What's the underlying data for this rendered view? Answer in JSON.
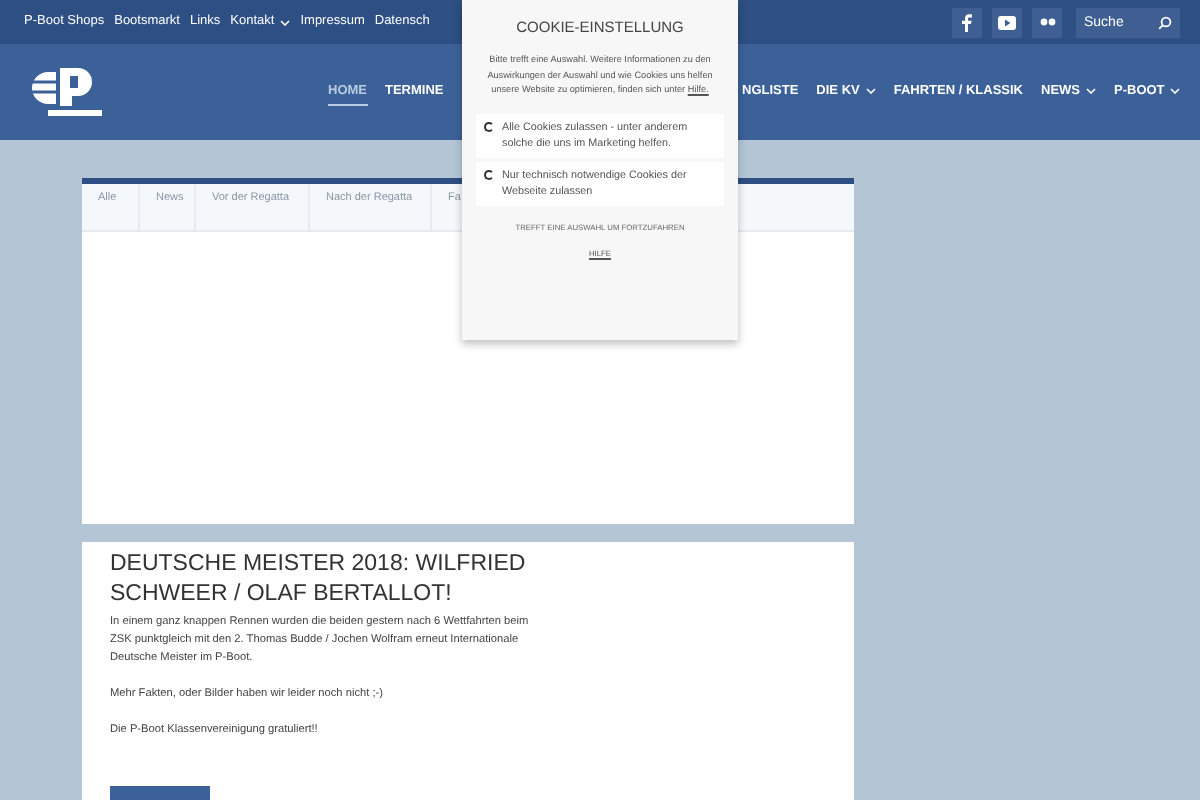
{
  "top_links": [
    {
      "label": "P-Boot Shops",
      "dropdown": false
    },
    {
      "label": "Bootsmarkt",
      "dropdown": false
    },
    {
      "label": "Links",
      "dropdown": false
    },
    {
      "label": "Kontakt",
      "dropdown": true
    },
    {
      "label": "Impressum",
      "dropdown": false
    },
    {
      "label": "Datensch",
      "dropdown": false
    }
  ],
  "search": {
    "placeholder": "Suche"
  },
  "nav_left": [
    {
      "label": "HOME",
      "selected": true,
      "dropdown": false
    },
    {
      "label": "TERMINE",
      "selected": false,
      "dropdown": false
    }
  ],
  "nav_right": [
    {
      "label": "NGLISTE",
      "selected": false,
      "dropdown": false
    },
    {
      "label": "DIE KV",
      "selected": false,
      "dropdown": true
    },
    {
      "label": "FAHRTEN / KLASSIK",
      "selected": false,
      "dropdown": false
    },
    {
      "label": "NEWS",
      "selected": false,
      "dropdown": true
    },
    {
      "label": "P-BOOT",
      "selected": false,
      "dropdown": true
    }
  ],
  "filters": [
    {
      "label": "Alle"
    },
    {
      "label": "News"
    },
    {
      "label": "Vor der Regatta"
    },
    {
      "label": "Nach der Regatta"
    },
    {
      "label": "Fa"
    }
  ],
  "post": {
    "title": "DEUTSCHE MEISTER 2018: WILFRIED SCHWEER / OLAF BERTALLOT!",
    "paragraphs": [
      "In einem ganz knappen Rennen wurden die beiden gestern nach 6 Wettfahrten beim ZSK punktgleich mit den 2. Thomas Budde / Jochen Wolfram erneut Internationale Deutsche Meister im P-Boot.",
      "Mehr Fakten, oder Bilder haben wir leider noch nicht ;-)",
      "Die P-Boot Klassenvereinigung gratuliert!!"
    ]
  },
  "cookie_dialog": {
    "title": "COOKIE-EINSTELLUNG",
    "intro": "Bitte trefft eine Auswahl. Weitere Informationen zu den Auswirkungen der Auswahl und wie Cookies uns helfen unsere Website zu optimieren, finden sich unter",
    "help_link": "Hilfe.",
    "options": [
      {
        "label": "Alle Cookies zulassen - unter anderem solche die uns im Marketing helfen.",
        "selected": false
      },
      {
        "label": "Nur technisch notwendige Cookies der Webseite zulassen",
        "selected": false
      }
    ],
    "prompt": "TREFFT EINE AUSWAHL UM FORTZUFAHREN",
    "help_button": "HILFE"
  }
}
